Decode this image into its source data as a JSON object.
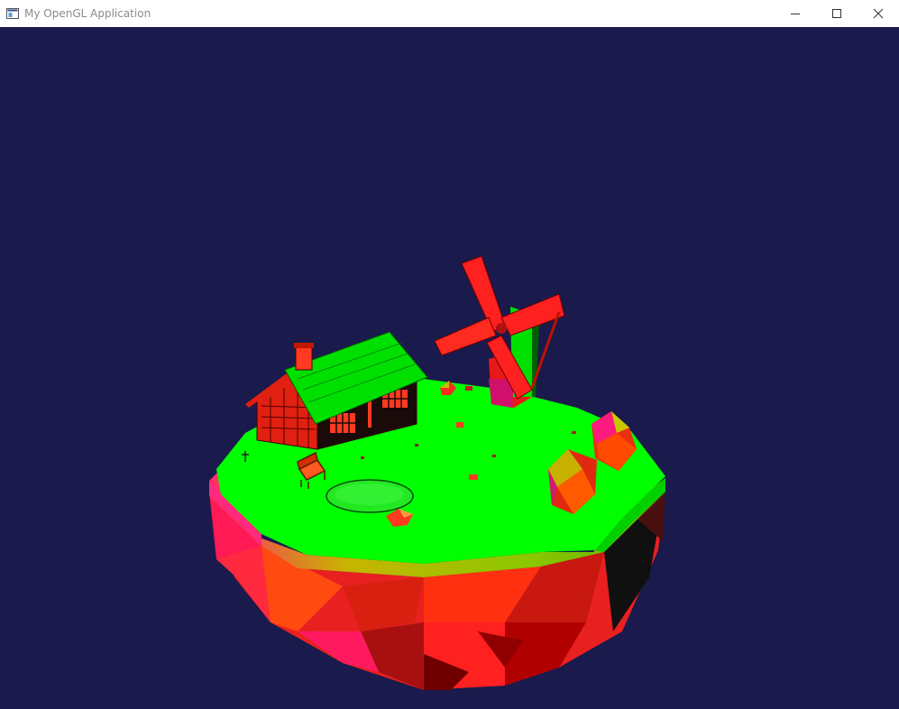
{
  "window": {
    "title": "My OpenGL Application",
    "controls": [
      "minimize-icon",
      "maximize-icon",
      "close-icon"
    ]
  },
  "scene": {
    "background_color": "#1a1a4c",
    "objects": [
      "floating-island",
      "house",
      "windmill",
      "bench",
      "pond",
      "rocks",
      "trees"
    ],
    "colors": {
      "grass": "#00ff00",
      "rock": "#ff2a2a",
      "accent_yellow": "#b9c400"
    }
  }
}
